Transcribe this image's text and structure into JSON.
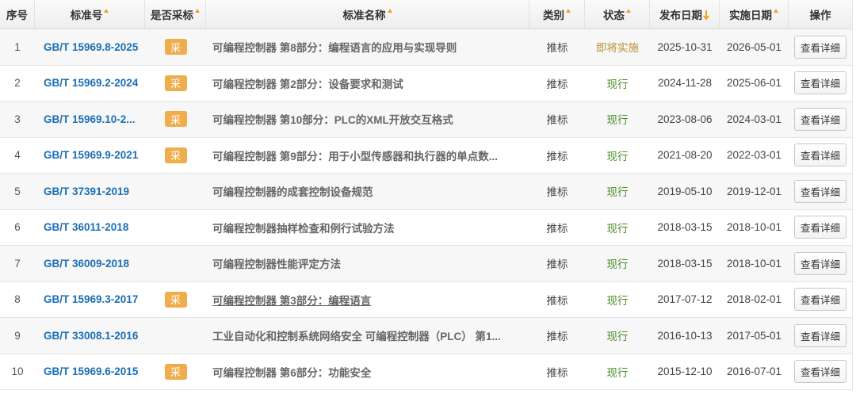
{
  "table": {
    "columns": [
      {
        "label": "序号"
      },
      {
        "label": "标准号",
        "sort_icon": "sort-up-icon"
      },
      {
        "label": "是否采标",
        "sort_icon": "sort-up-icon"
      },
      {
        "label": "标准名称",
        "sort_icon": "sort-up-icon"
      },
      {
        "label": "类别",
        "sort_icon": "sort-up-icon"
      },
      {
        "label": "状态",
        "sort_icon": "sort-up-icon"
      },
      {
        "label": "发布日期",
        "sort_icon": "sort-down-arrow-icon"
      },
      {
        "label": "实施日期",
        "sort_icon": "sort-up-icon"
      },
      {
        "label": "操作"
      }
    ],
    "adopted_badge_label": "采",
    "action_label": "查看详细",
    "rows": [
      {
        "no": 1,
        "code": "GB/T 15969.8-2025",
        "adopted": true,
        "name": "可编程控制器 第8部分：编程语言的应用与实现导则",
        "category": "推标",
        "status": "即将实施",
        "status_color": "#b89135",
        "publish_date": "2025-10-31",
        "effective_date": "2026-05-01"
      },
      {
        "no": 2,
        "code": "GB/T 15969.2-2024",
        "adopted": true,
        "name": "可编程控制器 第2部分：设备要求和测试",
        "category": "推标",
        "status": "现行",
        "status_color": "#4a8b2c",
        "publish_date": "2024-11-28",
        "effective_date": "2025-06-01"
      },
      {
        "no": 3,
        "code": "GB/T 15969.10-2...",
        "adopted": true,
        "name": "可编程控制器 第10部分：PLC的XML开放交互格式",
        "category": "推标",
        "status": "现行",
        "status_color": "#4a8b2c",
        "publish_date": "2023-08-06",
        "effective_date": "2024-03-01"
      },
      {
        "no": 4,
        "code": "GB/T 15969.9-2021",
        "adopted": true,
        "name": "可编程控制器 第9部分：用于小型传感器和执行器的单点数...",
        "category": "推标",
        "status": "现行",
        "status_color": "#4a8b2c",
        "publish_date": "2021-08-20",
        "effective_date": "2022-03-01"
      },
      {
        "no": 5,
        "code": "GB/T 37391-2019",
        "adopted": false,
        "name": "可编程控制器的成套控制设备规范",
        "category": "推标",
        "status": "现行",
        "status_color": "#4a8b2c",
        "publish_date": "2019-05-10",
        "effective_date": "2019-12-01"
      },
      {
        "no": 6,
        "code": "GB/T 36011-2018",
        "adopted": false,
        "name": "可编程控制器抽样检查和例行试验方法",
        "category": "推标",
        "status": "现行",
        "status_color": "#4a8b2c",
        "publish_date": "2018-03-15",
        "effective_date": "2018-10-01"
      },
      {
        "no": 7,
        "code": "GB/T 36009-2018",
        "adopted": false,
        "name": "可编程控制器性能评定方法",
        "category": "推标",
        "status": "现行",
        "status_color": "#4a8b2c",
        "publish_date": "2018-03-15",
        "effective_date": "2018-10-01"
      },
      {
        "no": 8,
        "code": "GB/T 15969.3-2017",
        "adopted": true,
        "name": "可编程控制器 第3部分：编程语言",
        "category": "推标",
        "status": "现行",
        "status_color": "#4a8b2c",
        "publish_date": "2017-07-12",
        "effective_date": "2018-02-01"
      },
      {
        "no": 9,
        "code": "GB/T 33008.1-2016",
        "adopted": false,
        "name": "工业自动化和控制系统网络安全 可编程控制器（PLC） 第1...",
        "category": "推标",
        "status": "现行",
        "status_color": "#4a8b2c",
        "publish_date": "2016-10-13",
        "effective_date": "2017-05-01"
      },
      {
        "no": 10,
        "code": "GB/T 15969.6-2015",
        "adopted": true,
        "name": "可编程控制器 第6部分：功能安全",
        "category": "推标",
        "status": "现行",
        "status_color": "#4a8b2c",
        "publish_date": "2015-12-10",
        "effective_date": "2016-07-01"
      }
    ]
  },
  "colors": {
    "link": "#1b6fb5",
    "sort_icon": "#f0a030",
    "badge_bg": "#f0ad4e",
    "status_upcoming": "#b89135",
    "status_current": "#4a8b2c",
    "row_stripe": "#f7f7f7"
  }
}
